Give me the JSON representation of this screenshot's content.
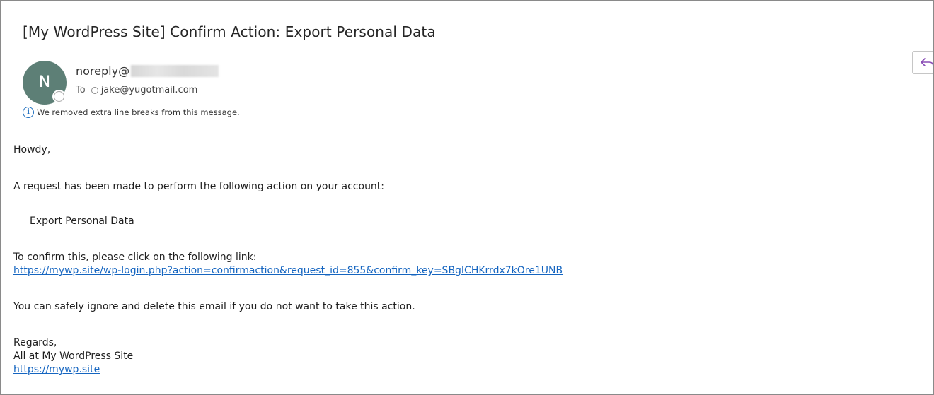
{
  "email": {
    "subject": "[My WordPress Site] Confirm Action: Export Personal Data",
    "avatar_initial": "N",
    "sender": "noreply@",
    "to_label": "To",
    "recipient": "jake@yugotmail.com",
    "info_notice": "We removed extra line breaks from this message."
  },
  "body": {
    "greeting": "Howdy,",
    "line1": "A request has been made to perform the following action on your account:",
    "action": "Export Personal Data",
    "line2": "To confirm this, please click on the following link:",
    "confirm_link": "https://mywp.site/wp-login.php?action=confirmaction&request_id=855&confirm_key=SBgICHKrrdx7kOre1UNB",
    "line3": "You can safely ignore and delete this email if you do not want to take this action.",
    "regards": "Regards,",
    "signature": "All at My WordPress Site",
    "site_link": "https://mywp.site"
  },
  "icons": {
    "reply": "reply-icon",
    "info": "info-icon",
    "presence": "presence-icon"
  },
  "colors": {
    "avatar_bg": "#5d7f76",
    "link": "#1565c0",
    "info_accent": "#1f6fbf",
    "reply_icon": "#8a4fb6"
  }
}
